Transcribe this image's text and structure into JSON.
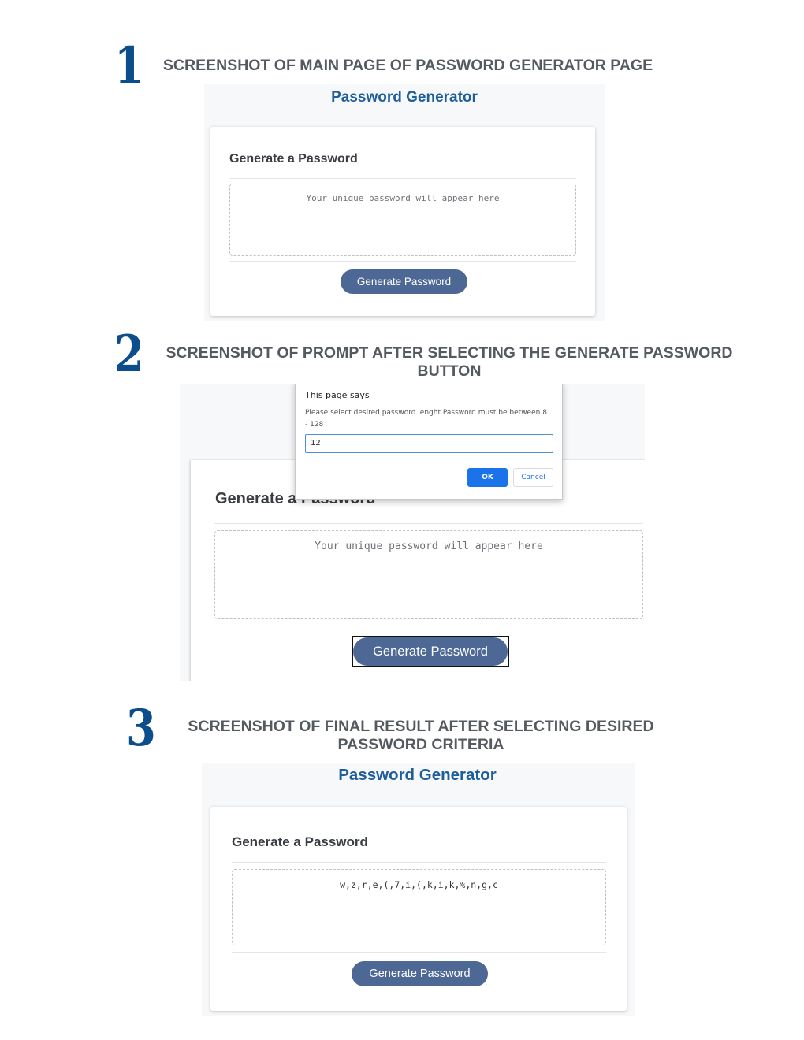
{
  "section1": {
    "number": "1",
    "heading": "SCREENSHOT OF MAIN PAGE OF PASSWORD GENERATOR PAGE",
    "app_title": "Password Generator",
    "card_title": "Generate a Password",
    "placeholder": "Your unique password will appear here",
    "button_label": "Generate Password"
  },
  "section2": {
    "number": "2",
    "heading_line1": "SCREENSHOT OF PROMPT AFTER SELECTING THE GENERATE PASSWORD",
    "heading_line2": "BUTTON",
    "dialog": {
      "title": "This page says",
      "message": "Please select desired password lenght.Password must be between 8 - 128",
      "input_value": "12",
      "ok_label": "OK",
      "cancel_label": "Cancel"
    },
    "card_title": "Generate a Password",
    "placeholder": "Your unique password will appear here",
    "button_label": "Generate Password"
  },
  "section3": {
    "number": "3",
    "heading_line1": "SCREENSHOT OF FINAL RESULT AFTER SELECTING DESIRED",
    "heading_line2": "PASSWORD CRITERIA",
    "app_title": "Password Generator",
    "card_title": "Generate a Password",
    "password_value": "w,z,r,e,(,7,i,(,k,i,k,%,n,g,c",
    "button_label": "Generate Password"
  },
  "colors": {
    "step_number": "#0d4d8c",
    "heading": "#555a60",
    "app_title": "#1e5e9a",
    "button": "#4d6895",
    "dialog_ok": "#1a73e8"
  }
}
